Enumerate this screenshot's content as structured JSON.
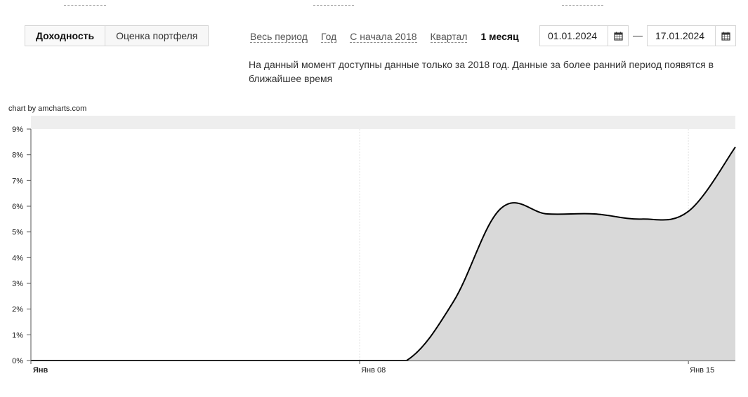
{
  "tabs": [
    {
      "label": "Доходность",
      "active": true
    },
    {
      "label": "Оценка портфеля",
      "active": false
    }
  ],
  "periods": [
    {
      "label": "Весь период",
      "active": false
    },
    {
      "label": "Год",
      "active": false
    },
    {
      "label": "С начала 2018",
      "active": false
    },
    {
      "label": "Квартал",
      "active": false
    },
    {
      "label": "1 месяц",
      "active": true
    }
  ],
  "date_range": {
    "from": "01.01.2024",
    "separator": "—",
    "to": "17.01.2024"
  },
  "notice": "На данный момент доступны данные только за 2018 год. Данные за более ранний период появятся в ближайшее время",
  "credit": "chart by amcharts.com",
  "chart_data": {
    "type": "area",
    "x": [
      1,
      2,
      3,
      4,
      5,
      6,
      7,
      8,
      9,
      10,
      11,
      12,
      13,
      14,
      15,
      16
    ],
    "values": [
      0,
      0,
      0,
      0,
      0,
      0,
      0,
      0,
      0.0,
      2.3,
      5.9,
      5.7,
      5.7,
      5.5,
      5.8,
      8.3
    ],
    "ylim": [
      0,
      9
    ],
    "y_ticks": [
      "0%",
      "1%",
      "2%",
      "3%",
      "4%",
      "5%",
      "6%",
      "7%",
      "8%",
      "9%"
    ],
    "x_ticks": [
      {
        "x": 1,
        "label": "Янв",
        "bold": true
      },
      {
        "x": 8,
        "label": "Янв 08",
        "bold": false
      },
      {
        "x": 15,
        "label": "Янв 15",
        "bold": false
      }
    ],
    "colors": {
      "line": "#000000",
      "fill": "#d9d9d9",
      "band": "#eeeeee"
    }
  }
}
